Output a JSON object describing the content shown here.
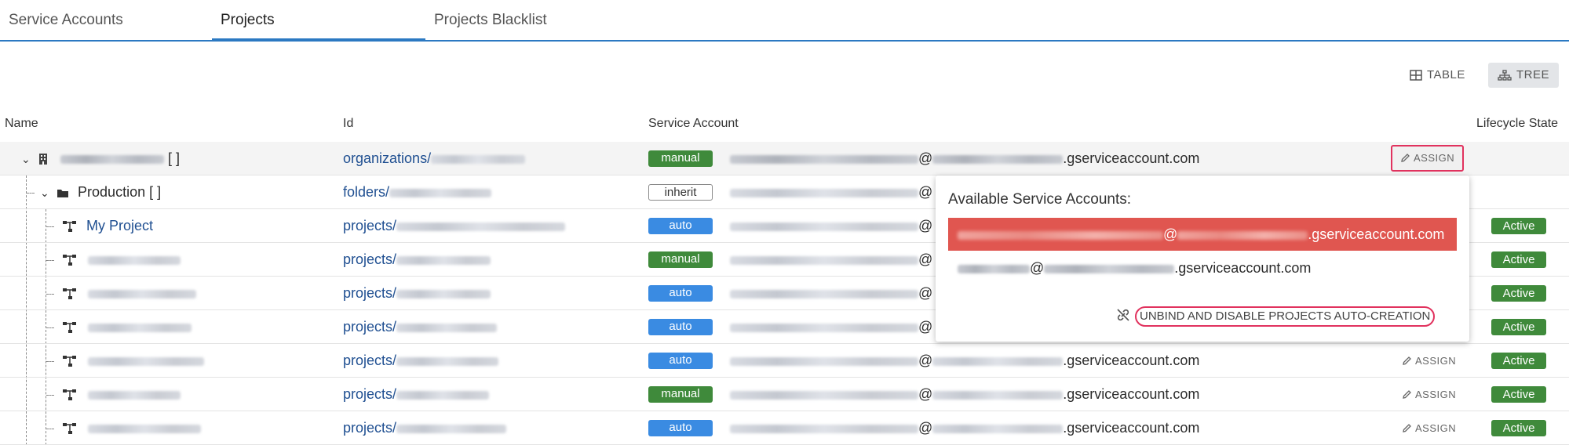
{
  "tabs": [
    {
      "label": "Service Accounts",
      "active": false
    },
    {
      "label": "Projects",
      "active": true
    },
    {
      "label": "Projects Blacklist",
      "active": false
    }
  ],
  "view_toggle": {
    "table_label": "TABLE",
    "tree_label": "TREE",
    "selected": "TREE"
  },
  "columns": {
    "name": "Name",
    "id": "Id",
    "service_account": "Service Account",
    "lifecycle": "Lifecycle State"
  },
  "sa_domain": ".gserviceaccount.com",
  "at": "@",
  "assign_label": "ASSIGN",
  "rows": [
    {
      "name_suffix": "[ ]",
      "id_prefix": "organizations/",
      "badge": "manual",
      "state": ""
    },
    {
      "name": "Production",
      "name_suffix": "[ ]",
      "id_prefix": "folders/",
      "badge": "inherit",
      "state": ""
    },
    {
      "name": "My Project",
      "id_prefix": "projects/",
      "badge": "auto",
      "state": "Active"
    },
    {
      "id_prefix": "projects/",
      "badge": "manual",
      "state": "Active"
    },
    {
      "id_prefix": "projects/",
      "badge": "auto",
      "state": "Active"
    },
    {
      "id_prefix": "projects/",
      "badge": "auto",
      "state": "Active"
    },
    {
      "id_prefix": "projects/",
      "badge": "auto",
      "state": "Active"
    },
    {
      "id_prefix": "projects/",
      "badge": "manual",
      "state": "Active"
    },
    {
      "id_prefix": "projects/",
      "badge": "auto",
      "state": "Active"
    }
  ],
  "popup": {
    "title": "Available Service Accounts:",
    "unbind_label": "UNBIND AND DISABLE PROJECTS AUTO-CREATION"
  },
  "colors": {
    "accent": "#2b79c2",
    "manual": "#3f8a3b",
    "auto": "#3a8be2",
    "selected": "#e05650",
    "highlight_border": "#e1325e"
  }
}
